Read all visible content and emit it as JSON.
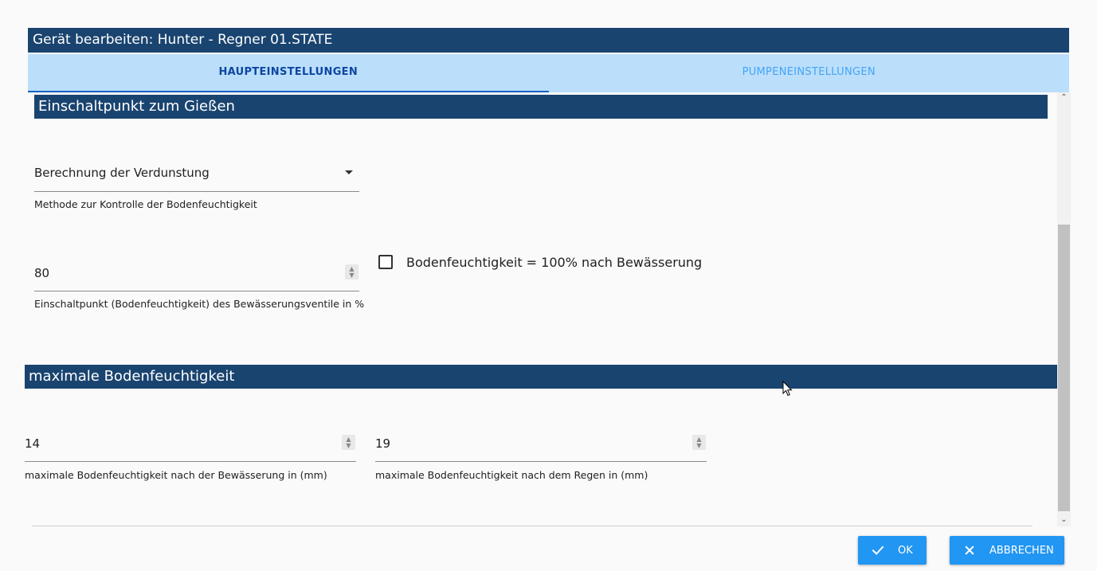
{
  "dialog": {
    "title": "Gerät bearbeiten: Hunter - Regner 01.STATE"
  },
  "tabs": [
    {
      "label": "HAUPTEINSTELLUNGEN",
      "active": true
    },
    {
      "label": "PUMPENEINSTELLUNGEN",
      "active": false
    }
  ],
  "section1": {
    "title": "Einschaltpunkt zum Gießen",
    "method_select": {
      "value": "Berechnung der Verdunstung",
      "helper": "Methode zur Kontrolle der Bodenfeuchtigkeit"
    },
    "switch_point": {
      "value": "80",
      "helper": "Einschaltpunkt (Bodenfeuchtigkeit) des Bewässerungsventile in %"
    },
    "checkbox": {
      "label": "Bodenfeuchtigkeit = 100% nach Bewässerung",
      "checked": false
    }
  },
  "section2": {
    "title": "maximale Bodenfeuchtigkeit",
    "max_after_irrigation": {
      "value": "14",
      "helper": "maximale Bodenfeuchtigkeit nach der Bewässerung in (mm)"
    },
    "max_after_rain": {
      "value": "19",
      "helper": "maximale Bodenfeuchtigkeit nach dem Regen in (mm)"
    }
  },
  "footer": {
    "ok_label": "OK",
    "cancel_label": "ABBRECHEN"
  },
  "colors": {
    "header_bg": "#1a4470",
    "tab_bg": "#bbdefb",
    "button_bg": "#2196f3"
  }
}
